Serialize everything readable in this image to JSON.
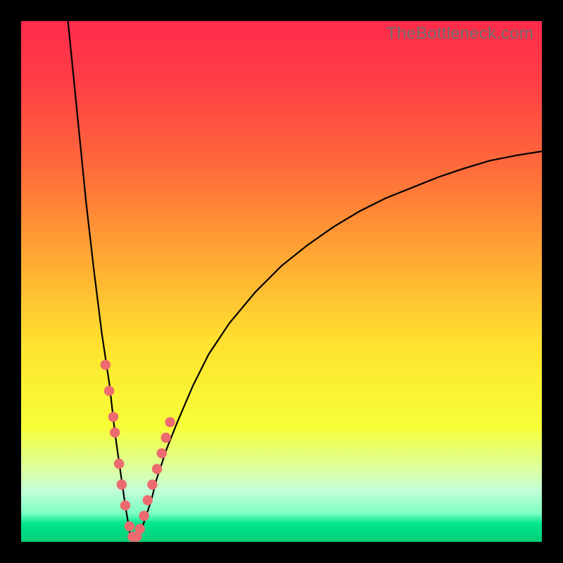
{
  "watermark": {
    "text": "TheBottleneck.com"
  },
  "colors": {
    "frame": "#000000",
    "curve_stroke": "#000000",
    "marker_fill": "#ec6b6e",
    "gradient_stops": [
      {
        "offset": 0.0,
        "color": "#ff2b4b"
      },
      {
        "offset": 0.12,
        "color": "#ff3f45"
      },
      {
        "offset": 0.28,
        "color": "#ff6a3a"
      },
      {
        "offset": 0.45,
        "color": "#ffa733"
      },
      {
        "offset": 0.62,
        "color": "#ffe22f"
      },
      {
        "offset": 0.78,
        "color": "#f6ff38"
      },
      {
        "offset": 0.86,
        "color": "#dcffa0"
      },
      {
        "offset": 0.9,
        "color": "#c4ffd7"
      },
      {
        "offset": 0.945,
        "color": "#7effc3"
      },
      {
        "offset": 0.965,
        "color": "#00e58c"
      },
      {
        "offset": 1.0,
        "color": "#00cf77"
      }
    ]
  },
  "chart_data": {
    "type": "line",
    "title": "",
    "xlabel": "",
    "ylabel": "",
    "xlim": [
      0,
      100
    ],
    "ylim": [
      0,
      100
    ],
    "notes": "V-shaped bottleneck curve. y represents mismatch/bottleneck percentage (green≈0 at bottom, red≈100 at top). Minimum near x≈21 where y≈0. Left branch rises steeply to y≈100 at x≈9. Right branch rises gently, reaching y≈75 at x=100.",
    "series": [
      {
        "name": "bottleneck-curve",
        "x": [
          9,
          10,
          11,
          12.5,
          14,
          15.5,
          17,
          18,
          19,
          20,
          21,
          22,
          23,
          24,
          25,
          26,
          28,
          30,
          33,
          36,
          40,
          45,
          50,
          55,
          60,
          65,
          70,
          75,
          80,
          85,
          90,
          95,
          100
        ],
        "y": [
          100,
          90,
          80,
          65,
          52,
          40,
          30,
          21,
          14,
          7,
          1,
          0.5,
          2,
          5,
          8,
          12,
          18,
          23,
          30,
          36,
          42,
          48,
          53,
          57,
          60.5,
          63.5,
          66,
          68,
          70,
          71.7,
          73.2,
          74.2,
          75
        ]
      }
    ],
    "markers": {
      "name": "highlighted-points",
      "note": "Salmon dots clustered near the curve minimum on both branches",
      "x": [
        16.2,
        16.9,
        17.7,
        18.0,
        18.8,
        19.3,
        20.0,
        20.8,
        21.4,
        22.2,
        22.8,
        23.6,
        24.3,
        25.2,
        26.1,
        27.0,
        27.8,
        28.6
      ],
      "y": [
        34,
        29,
        24,
        21,
        15,
        11,
        7,
        3,
        1,
        1,
        2.5,
        5,
        8,
        11,
        14,
        17,
        20,
        23
      ]
    }
  }
}
